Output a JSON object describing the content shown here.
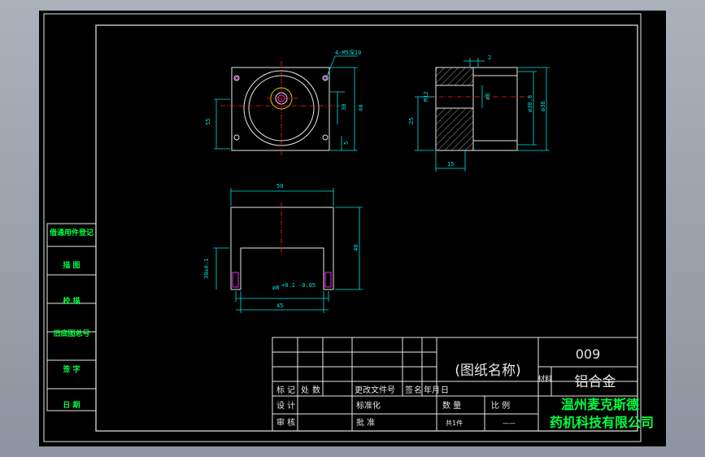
{
  "title_block": {
    "part_number": "009",
    "drawing_name": "(图纸名称)",
    "material_label": "材料",
    "material": "铝合金",
    "company_line1": "温州麦克斯德",
    "company_line2": "药机科技有限公司",
    "header_labels": [
      "标",
      "记",
      "处",
      "数",
      "更改文件号",
      "签",
      "名",
      "年",
      "月",
      "日"
    ],
    "row_design": "设 计",
    "row_design_std": "标准化",
    "row_review": "审 核",
    "row_approve": "批 准",
    "qty_label": "数 量",
    "scale_label": "比 例",
    "qty_value": "共1件",
    "scale_value": "——"
  },
  "side_stamps": [
    "借通用件登记",
    "描 图",
    "校 描",
    "旧底图总号",
    "签 字",
    "日 期"
  ],
  "dimensions": {
    "thread_callout": "4-M5深10",
    "front_height": "55",
    "front_inner": "30",
    "front_right": "40",
    "front_small": "5",
    "side_top": "2",
    "side_thread": "M12",
    "side_bore": "ø8",
    "side_dia1": "ø30.8",
    "side_dia2": "ø38",
    "side_height": "25",
    "side_width": "15",
    "bottom_width": "50",
    "bottom_height": "40",
    "bottom_slot": "30±0.1",
    "bottom_hole": "ø8",
    "bottom_hole_tol": "+0.1\n-0.05",
    "bottom_inner": "45"
  }
}
